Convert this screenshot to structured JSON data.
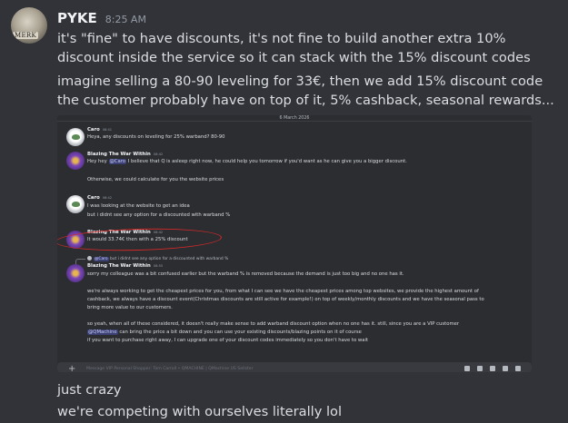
{
  "author": {
    "name": "PYKE",
    "timestamp": "8:25 AM",
    "avatar_text": "MERK"
  },
  "messages": [
    "it's \"fine\" to have discounts, it's not fine to build another extra 10% discount inside the service so it can stack with the 15% discount codes",
    "imagine selling a 80-90 leveling for 33€, then we add 15% discount code the customer probably have on top of it, 5% cashback, seasonal rewards...",
    "just crazy",
    "we're competing with ourselves literally lol"
  ],
  "screenshot": {
    "date_divider": "6 March 2026",
    "chat": [
      {
        "author": "Caro",
        "time": "08:41",
        "lines": [
          "Heya, any discounts on leveling for 25% warband? 80-90"
        ]
      },
      {
        "author": "Blazing The War Within",
        "time": "08:42",
        "lines": [
          {
            "pre": "Hey hey ",
            "mention": "@Caro",
            "post": " I believe that Q is asleep right now, he could help you tomorrow if you'd want as he can give you a bigger discount."
          },
          "Otherwise, we could calculate for you the website prices"
        ]
      },
      {
        "author": "Caro",
        "time": "08:42",
        "lines": [
          "I was looking at the website to get an idea",
          "but i didnt see any option for a discounted with warband %"
        ]
      },
      {
        "author": "Blazing The War Within",
        "time": "08:42",
        "lines": [
          "It would 33.74€ then with a 25% discount"
        ]
      },
      {
        "author": "Blazing The War Within",
        "time": "08:55",
        "lines": [
          "sorry my colleague was a bit confused earlier but the warband % is removed because the demand is just too big and no one has it.",
          "we're always working to get the cheapest prices for you, from what I can see we have the cheapest prices among top websites, we provide the highest amount of",
          "cashback, we always have a discount event(Christmas discounts are still active for example!) on top of weekly/monthly discounts and we have the seasonal pass to",
          "bring more value to our customers.",
          "so yeah, when all of these considered, it doesn't really make sense to add warband discount option when no one has it. still, since you are a VIP customer",
          {
            "pre": "",
            "mention": "@QMachine",
            "post": " can bring the price a bit down and you can use your existing discounts/blazing points on it of course"
          },
          "if you want to purchase right away, I can upgrade one of your discount codes immediately so you don't have to wait"
        ]
      }
    ],
    "reply_preview": {
      "mention": "@Caro",
      "text": " but i didnt see any option for a discounted with warband %"
    },
    "input_placeholder": "Message VIP Personal Shopper: Tom Carroll • QMACHINE | QMachine US Sellster"
  }
}
